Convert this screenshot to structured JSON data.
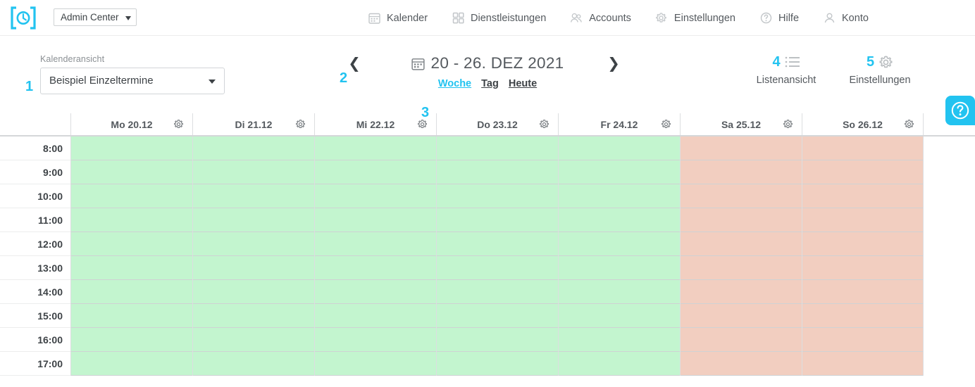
{
  "topbar": {
    "logo_icon": "clock-bracket-logo",
    "brand_select": {
      "label": "Admin Center",
      "icon": "chevron-down-icon"
    },
    "nav": [
      {
        "label": "Kalender",
        "icon": "calendar-icon"
      },
      {
        "label": "Dienstleistungen",
        "icon": "grid-squares-icon"
      },
      {
        "label": "Accounts",
        "icon": "users-icon"
      },
      {
        "label": "Einstellungen",
        "icon": "gear-icon"
      },
      {
        "label": "Hilfe",
        "icon": "question-circle-icon"
      },
      {
        "label": "Konto",
        "icon": "user-icon"
      }
    ]
  },
  "toolbar": {
    "calendar_view": {
      "marker": "1",
      "label": "Kalenderansicht",
      "value": "Beispiel Einzeltermine",
      "icon": "chevron-down-icon"
    },
    "date_nav": {
      "marker_prev": "2",
      "prev_icon": "chevron-left-icon",
      "next_icon": "chevron-right-icon",
      "calendar_icon": "calendar-icon",
      "range": "20 - 26. DEZ 2021",
      "marker_views": "3",
      "views": [
        {
          "label": "Woche",
          "active": true
        },
        {
          "label": "Tag",
          "active": false
        },
        {
          "label": "Heute",
          "active": false
        }
      ]
    },
    "list_view": {
      "marker": "4",
      "label": "Listenansicht",
      "icon": "list-icon"
    },
    "settings": {
      "marker": "5",
      "label": "Einstellungen",
      "icon": "gear-icon"
    },
    "help": {
      "icon": "question-circle-icon",
      "color": "#22c3f0"
    }
  },
  "calendar": {
    "gear_icon": "gear-icon",
    "days": [
      {
        "label": "Mo 20.12",
        "status": "open"
      },
      {
        "label": "Di 21.12",
        "status": "open"
      },
      {
        "label": "Mi 22.12",
        "status": "open"
      },
      {
        "label": "Do 23.12",
        "status": "open"
      },
      {
        "label": "Fr 24.12",
        "status": "open"
      },
      {
        "label": "Sa 25.12",
        "status": "closed"
      },
      {
        "label": "So 26.12",
        "status": "closed"
      }
    ],
    "times": [
      "8:00",
      "9:00",
      "10:00",
      "11:00",
      "12:00",
      "13:00",
      "14:00",
      "15:00",
      "16:00",
      "17:00"
    ],
    "colors": {
      "open": "#c3f5cf",
      "closed": "#f2cec0",
      "accent": "#22c3f0"
    }
  }
}
